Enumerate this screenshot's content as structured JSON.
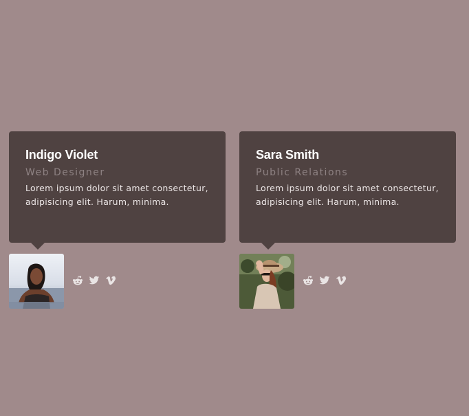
{
  "cards": [
    {
      "name": "Indigo Violet",
      "role": "Web Designer",
      "description": "Lorem ipsum dolor sit amet consectetur, adipisicing elit. Harum, minima.",
      "social_icons": [
        "reddit-icon",
        "twitter-icon",
        "vimeo-icon"
      ]
    },
    {
      "name": "Sara Smith",
      "role": "Public Relations",
      "description": "Lorem ipsum dolor sit amet consectetur, adipisicing elit. Harum, minima.",
      "social_icons": [
        "reddit-icon",
        "twitter-icon",
        "vimeo-icon"
      ]
    }
  ],
  "colors": {
    "page_background": "#a08a8b",
    "card_background": "#4f4241",
    "name_text": "#ffffff",
    "role_text": "#8e8283",
    "body_text": "#ece6e6",
    "icon_color": "#e9e4e4"
  }
}
